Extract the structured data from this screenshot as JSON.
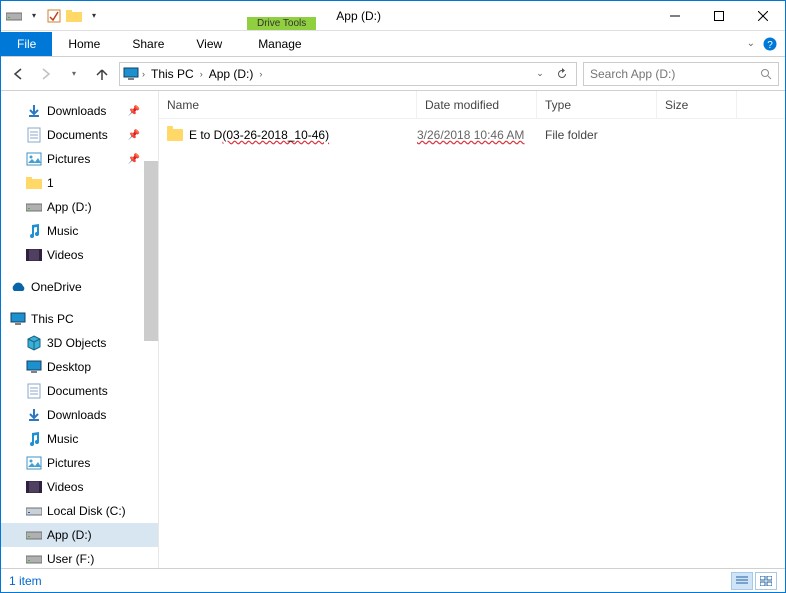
{
  "title": "App (D:)",
  "tool_tab_group": "Drive Tools",
  "tool_tab_name": "Manage",
  "ribbon": {
    "file": "File",
    "home": "Home",
    "share": "Share",
    "view": "View"
  },
  "nav": {
    "crumbs": [
      "This PC",
      "App (D:)"
    ],
    "search_placeholder": "Search App (D:)"
  },
  "tree": {
    "quick": [
      {
        "label": "Downloads",
        "icon": "download",
        "pinned": true
      },
      {
        "label": "Documents",
        "icon": "document",
        "pinned": true
      },
      {
        "label": "Pictures",
        "icon": "picture",
        "pinned": true
      },
      {
        "label": "1",
        "icon": "folder",
        "pinned": false
      },
      {
        "label": "App (D:)",
        "icon": "drive",
        "pinned": false
      },
      {
        "label": "Music",
        "icon": "music",
        "pinned": false
      },
      {
        "label": "Videos",
        "icon": "video",
        "pinned": false
      }
    ],
    "onedrive": "OneDrive",
    "thispc_label": "This PC",
    "thispc": [
      {
        "label": "3D Objects",
        "icon": "cube"
      },
      {
        "label": "Desktop",
        "icon": "desktop"
      },
      {
        "label": "Documents",
        "icon": "document"
      },
      {
        "label": "Downloads",
        "icon": "download"
      },
      {
        "label": "Music",
        "icon": "music"
      },
      {
        "label": "Pictures",
        "icon": "picture"
      },
      {
        "label": "Videos",
        "icon": "video"
      },
      {
        "label": "Local Disk (C:)",
        "icon": "disk"
      },
      {
        "label": "App (D:)",
        "icon": "drive",
        "selected": true
      },
      {
        "label": "User (F:)",
        "icon": "drive"
      }
    ]
  },
  "columns": {
    "name": "Name",
    "date": "Date modified",
    "type": "Type",
    "size": "Size"
  },
  "files": [
    {
      "name_pre": "E to D",
      "name_marked": "(03-26-2018_10-46)",
      "date": "3/26/2018 10:46 AM",
      "type": "File folder"
    }
  ],
  "status": "1 item"
}
